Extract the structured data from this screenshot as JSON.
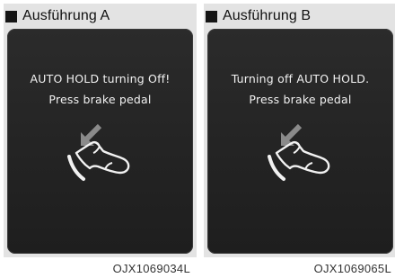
{
  "panels": [
    {
      "title": "Ausführung A",
      "message_line1": "AUTO HOLD turning Off!",
      "message_line2": "Press brake pedal",
      "image_code": "OJX1069034L"
    },
    {
      "title": "Ausführung B",
      "message_line1": "Turning off AUTO HOLD.",
      "message_line2": "Press brake pedal",
      "image_code": "OJX1069065L"
    }
  ],
  "colors": {
    "screen_background": "#262626",
    "screen_text": "#f2f2f2",
    "panel_background": "#e3e3e3",
    "icon_gray": "#8a8a8a"
  },
  "icons": [
    "black-square-icon",
    "foot-on-brake-pedal-icon",
    "arrow-down-left-icon"
  ]
}
